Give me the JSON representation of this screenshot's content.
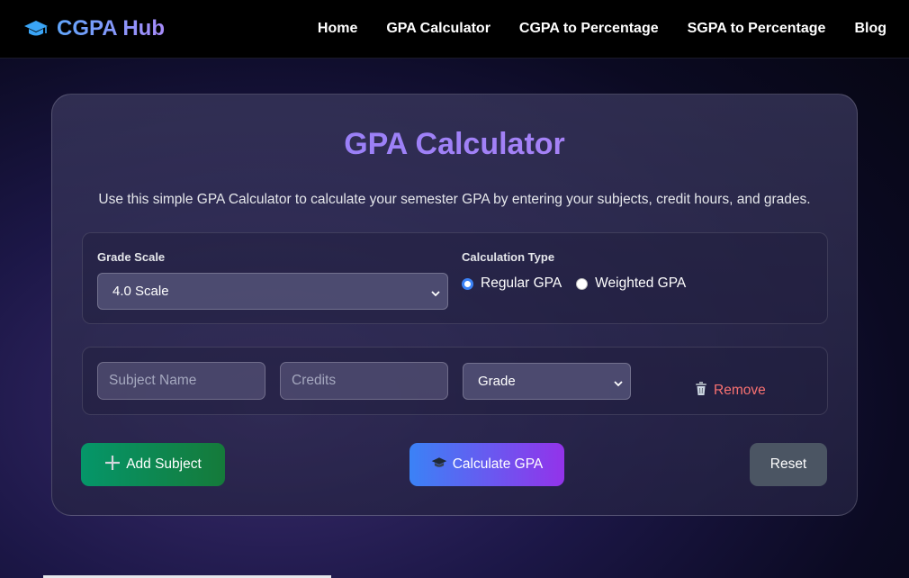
{
  "header": {
    "brand": "CGPA Hub",
    "nav": [
      {
        "label": "Home"
      },
      {
        "label": "GPA Calculator"
      },
      {
        "label": "CGPA to Percentage"
      },
      {
        "label": "SGPA to Percentage"
      },
      {
        "label": "Blog"
      }
    ]
  },
  "main": {
    "title": "GPA Calculator",
    "description": "Use this simple GPA Calculator to calculate your semester GPA by entering your subjects, credit hours, and grades.",
    "settings": {
      "grade_scale_label": "Grade Scale",
      "grade_scale_value": "4.0 Scale",
      "calc_type_label": "Calculation Type",
      "options": [
        {
          "label": "Regular GPA",
          "selected": true
        },
        {
          "label": "Weighted GPA",
          "selected": false
        }
      ]
    },
    "subject_row": {
      "subject_placeholder": "Subject Name",
      "credits_placeholder": "Credits",
      "grade_value": "Grade",
      "remove_label": "Remove"
    },
    "actions": {
      "add_label": "Add Subject",
      "calculate_label": "Calculate GPA",
      "reset_label": "Reset"
    }
  },
  "colors": {
    "accent": "#a78bfa",
    "brand_gradient_start": "#60a5fa",
    "add_button": "#059669",
    "calc_gradient_start": "#3b82f6",
    "calc_gradient_end": "#9333ea",
    "remove": "#f87171",
    "reset_button": "#4b5563"
  },
  "icons": {
    "brand": "graduation-cap-icon",
    "remove": "trash-icon",
    "add": "plus-icon",
    "calculate": "graduation-cap-icon"
  }
}
